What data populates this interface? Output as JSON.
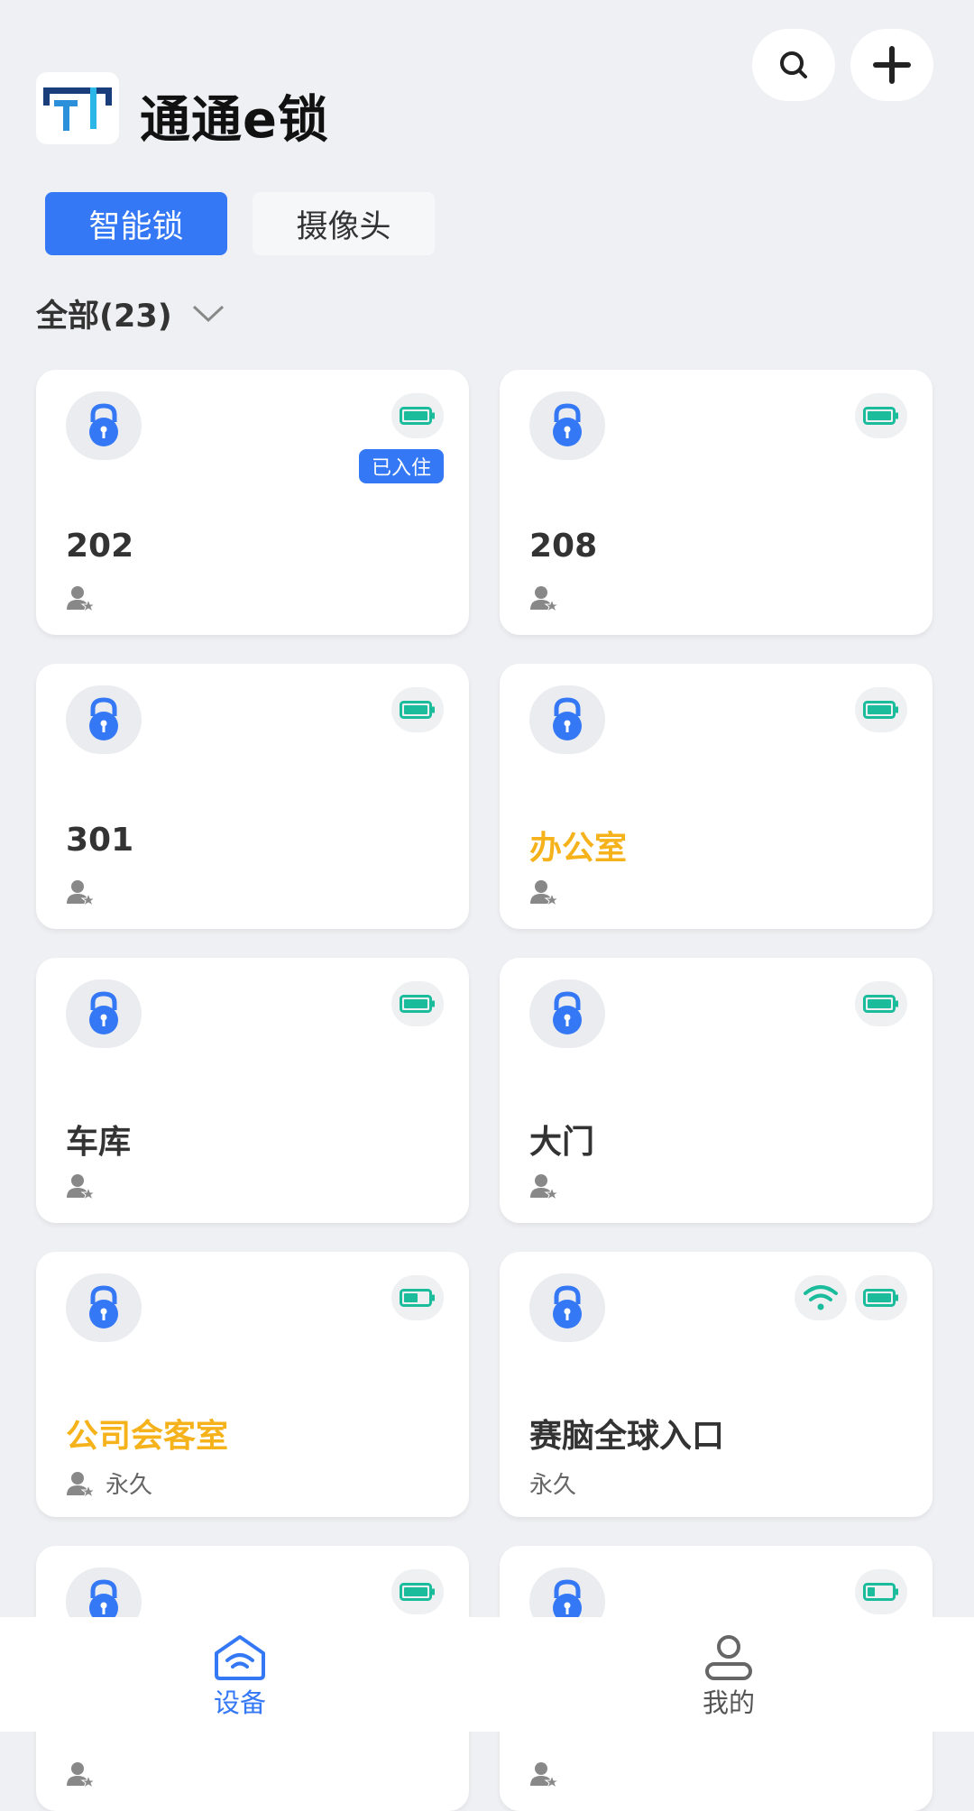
{
  "app": {
    "title": "通通e锁"
  },
  "header": {
    "search_icon": "search-icon",
    "add_icon": "plus-icon"
  },
  "tabs": [
    {
      "label": "智能锁",
      "active": true
    },
    {
      "label": "摄像头",
      "active": false
    }
  ],
  "filter": {
    "label": "全部(23)"
  },
  "colors": {
    "accent": "#3478f6",
    "warning": "#f5b21a",
    "battery": "#1abc9c",
    "wifi": "#1abc9c"
  },
  "devices": [
    {
      "name": "202",
      "badge": "已入住",
      "sub": "",
      "battery": "full"
    },
    {
      "name": "208",
      "sub": "",
      "battery": "full"
    },
    {
      "name": "301",
      "sub": "",
      "battery": "full"
    },
    {
      "name": "办公室",
      "sub": "",
      "battery": "full",
      "highlight": true
    },
    {
      "name": "车库",
      "sub": "",
      "battery": "full"
    },
    {
      "name": "大门",
      "sub": "",
      "battery": "full"
    },
    {
      "name": "公司会客室",
      "sub": "永久",
      "battery": "half",
      "highlight": true
    },
    {
      "name": "赛脑全球入口",
      "sub": "永久",
      "battery": "full",
      "wifi": true
    },
    {
      "name": "",
      "sub": "",
      "battery": "full"
    },
    {
      "name": "",
      "sub": "",
      "battery": "low"
    }
  ],
  "bottom_nav": [
    {
      "label": "设备",
      "icon": "home-signal-icon",
      "active": true
    },
    {
      "label": "我的",
      "icon": "user-icon",
      "active": false
    }
  ]
}
